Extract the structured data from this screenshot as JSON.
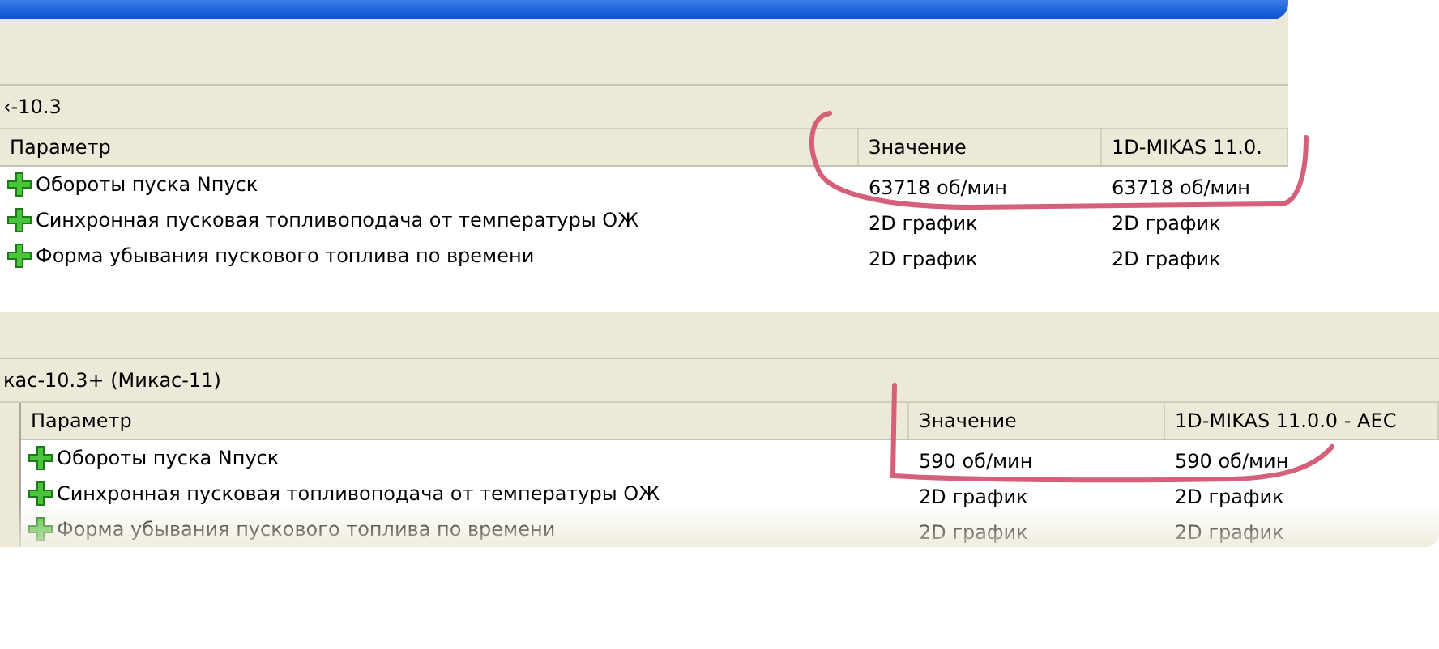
{
  "panels": [
    {
      "title": "‹-10.3",
      "columns": [
        "Параметр",
        "Значение",
        "1D-MIKAS 11.0."
      ],
      "rows": [
        {
          "name": "Обороты пуска Nпуск",
          "value": "63718 об/мин",
          "column_3": "63718 об/мин"
        },
        {
          "name": "Синхронная пусковая топливоподача от температуры ОЖ",
          "value": "2D график",
          "column_3": "2D график"
        },
        {
          "name": "Форма убывания пускового топлива по времени",
          "value": "2D график",
          "column_3": "2D график"
        }
      ]
    },
    {
      "title": "кас-10.3+ (Микас-11)",
      "columns": [
        "Параметр",
        "Значение",
        "1D-MIKAS 11.0.0 - AEC"
      ],
      "rows": [
        {
          "name": "Обороты пуска Nпуск",
          "value": "590 об/мин",
          "column_3": "590 об/мин"
        },
        {
          "name": "Синхронная пусковая топливоподача от температуры ОЖ",
          "value": "2D график",
          "column_3": "2D график"
        },
        {
          "name": "Форма убывания пускового топлива по времени",
          "value": "2D график",
          "column_3": "2D график"
        }
      ]
    }
  ]
}
